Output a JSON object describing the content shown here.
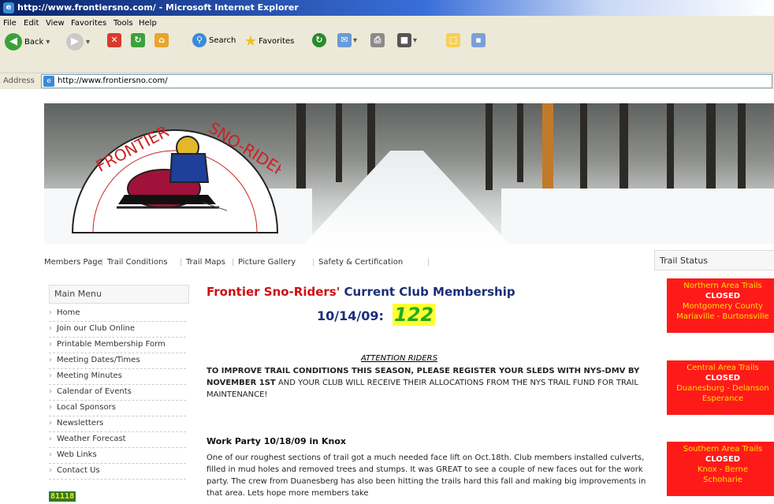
{
  "window": {
    "title": "http://www.frontiersno.com/ - Microsoft Internet Explorer"
  },
  "menubar": [
    "File",
    "Edit",
    "View",
    "Favorites",
    "Tools",
    "Help"
  ],
  "toolbar": {
    "back_label": "Back",
    "search_label": "Search",
    "favorites_label": "Favorites"
  },
  "address": {
    "label": "Address",
    "url": "http://www.frontiersno.com/"
  },
  "logo": {
    "text_left": "FRONTIER",
    "text_right": "SNO-RIDERS"
  },
  "nav": [
    "Members Page",
    "Trail Conditions",
    "Trail Maps",
    "Picture Gallery",
    "Safety & Certification"
  ],
  "sidebar": {
    "title": "Main Menu",
    "items": [
      "Home",
      "Join our Club Online",
      "Printable Membership Form",
      "Meeting Dates/Times",
      "Meeting Minutes",
      "Calendar of Events",
      "Local Sponsors",
      "Newsletters",
      "Weather Forecast",
      "Web Links",
      "Contact Us"
    ],
    "counter": "81118"
  },
  "main": {
    "heading_red": "Frontier Sno-Riders'",
    "heading_blue": " Current Club Membership",
    "date": "10/14/09:",
    "count": "122",
    "attention": "ATTENTION RIDERS",
    "attention_bold": "TO IMPROVE TRAIL CONDITIONS THIS SEASON, PLEASE REGISTER YOUR SLEDS WITH NYS-DMV BY NOVEMBER 1ST",
    "attention_rest": " AND YOUR CLUB WILL RECEIVE THEIR ALLOCATIONS FROM THE NYS TRAIL FUND FOR TRAIL MAINTENANCE!",
    "work_title": "Work Party 10/18/09 in Knox",
    "work_text": "One of our roughest sections of trail got a much needed face lift on Oct.18th.  Club members installed culverts, filled in mud holes and removed trees and stumps.  It was GREAT to see a couple of new faces out for the work party. The crew from Duanesberg has also been hitting the trails hard this fall and making big improvements in that area.  Lets hope more members take"
  },
  "trail_status": {
    "title": "Trail Status",
    "boxes": [
      {
        "area": "Northern  Area Trails",
        "status": "CLOSED",
        "l1": "Montgomery County",
        "l2": "Mariaville - Burtonsville"
      },
      {
        "area": "Central  Area Trails",
        "status": "CLOSED",
        "l1": "Duanesburg - Delanson",
        "l2": "Esperance"
      },
      {
        "area": "Southern Area Trails",
        "status": "CLOSED",
        "l1": "Knox - Berne",
        "l2": "Schoharie"
      }
    ]
  },
  "colors": {
    "heading_blue": "#1a2e7a",
    "heading_red": "#cc1111",
    "trail_red": "#ff1a1a",
    "trail_yellow": "#ffe000",
    "count_highlight": "#ffff33",
    "count_green": "#22aa22"
  }
}
